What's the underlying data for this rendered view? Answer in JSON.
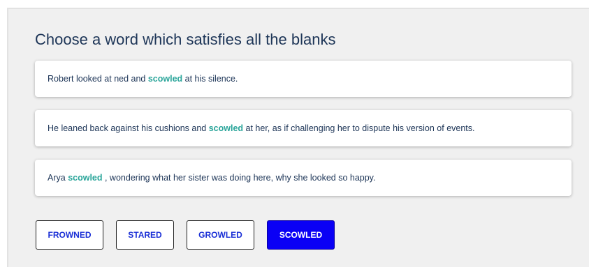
{
  "question": {
    "title": "Choose a word which satisfies all the blanks"
  },
  "sentences": [
    {
      "before": "Robert looked at ned and ",
      "word": "scowled",
      "after": " at his silence."
    },
    {
      "before": "He leaned back against his cushions and ",
      "word": "scowled",
      "after": " at her, as if challenging her to dispute his version of events."
    },
    {
      "before": "Arya ",
      "word": "scowled",
      "after": " , wondering what her sister was doing here, why she looked so happy."
    }
  ],
  "options": [
    {
      "label": "FROWNED",
      "selected": false
    },
    {
      "label": "STARED",
      "selected": false
    },
    {
      "label": "GROWLED",
      "selected": false
    },
    {
      "label": "SCOWLED",
      "selected": true
    }
  ],
  "colors": {
    "highlight": "#2aa59a",
    "title": "#1d3557",
    "selected_button": "#0a00f5",
    "button_text": "#1a2fd6"
  }
}
